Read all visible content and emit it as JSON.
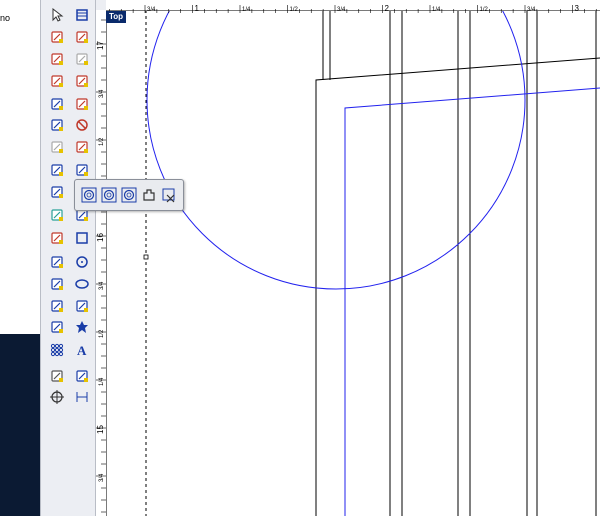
{
  "left_panel": {
    "partial_text": "no"
  },
  "view_label": "Top",
  "ruler_top": {
    "labels": [
      {
        "text": "3/4",
        "kind": "frac"
      },
      {
        "text": "1",
        "kind": "num"
      },
      {
        "text": "1/4",
        "kind": "frac"
      },
      {
        "text": "1/2",
        "kind": "frac"
      },
      {
        "text": "3/4",
        "kind": "frac"
      },
      {
        "text": "2",
        "kind": "num"
      },
      {
        "text": "1/4",
        "kind": "frac"
      },
      {
        "text": "1/2",
        "kind": "frac"
      },
      {
        "text": "3/4",
        "kind": "frac"
      },
      {
        "text": "3",
        "kind": "num"
      },
      {
        "text": "1/4",
        "kind": "frac"
      }
    ]
  },
  "ruler_left": {
    "labels": [
      {
        "text": "17",
        "kind": "num"
      },
      {
        "text": "3/4",
        "kind": "frac"
      },
      {
        "text": "1/2",
        "kind": "frac"
      },
      {
        "text": "1/4",
        "kind": "frac"
      },
      {
        "text": "16",
        "kind": "num"
      },
      {
        "text": "3/4",
        "kind": "frac"
      },
      {
        "text": "1/2",
        "kind": "frac"
      },
      {
        "text": "1/4",
        "kind": "frac"
      },
      {
        "text": "15",
        "kind": "num"
      },
      {
        "text": "3/4",
        "kind": "frac"
      }
    ]
  },
  "toolbar": {
    "tools": [
      {
        "name": "select-arrow-icon",
        "color": "#333333"
      },
      {
        "name": "layer-stack-icon",
        "color": "#1a3da8"
      },
      {
        "name": "node-edit-icon",
        "color": "#c0392b"
      },
      {
        "name": "transform-icon",
        "color": "#c0392b"
      },
      {
        "name": "resize-icon",
        "color": "#c0392b"
      },
      {
        "name": "grid-disabled-icon",
        "color": "#aaaaaa"
      },
      {
        "name": "rotate-icon",
        "color": "#c0392b"
      },
      {
        "name": "frame-icon",
        "color": "#c0392b"
      },
      {
        "name": "mirror-icon",
        "color": "#1a3da8"
      },
      {
        "name": "panel-icon",
        "color": "#c0392b"
      },
      {
        "name": "group-icon",
        "color": "#1a3da8"
      },
      {
        "name": "no-entry-icon",
        "color": "#c0392b"
      },
      {
        "name": "clone-disabled-icon",
        "color": "#aaaaaa"
      },
      {
        "name": "ruler-tool-icon",
        "color": "#c0392b"
      },
      {
        "name": "move-points-icon",
        "color": "#1a3da8"
      },
      {
        "name": "vase-icon",
        "color": "#1a3da8"
      },
      {
        "name": "boolean-icon",
        "color": "#1a3da8"
      },
      {
        "name": "hatch-icon",
        "color": "#333333"
      },
      {
        "name": "arrow-cursor-icon",
        "color": "#2aa198"
      },
      {
        "name": "curve-connect-icon",
        "color": "#1a3da8"
      },
      {
        "name": "pen-icon",
        "color": "#c0392b"
      },
      {
        "name": "rectangle-icon",
        "color": "#1a3da8"
      },
      {
        "name": "polyline-icon",
        "color": "#1a3da8"
      },
      {
        "name": "circle-icon",
        "color": "#1a3da8"
      },
      {
        "name": "bezier-icon",
        "color": "#1a3da8"
      },
      {
        "name": "ellipse-icon",
        "color": "#1a3da8"
      },
      {
        "name": "spline-icon",
        "color": "#1a3da8"
      },
      {
        "name": "polygon-icon",
        "color": "#1a3da8"
      },
      {
        "name": "fill-shape-icon",
        "color": "#1a3da8"
      },
      {
        "name": "star-icon",
        "color": "#1a3da8"
      },
      {
        "name": "array-grid-icon",
        "color": "#1a3da8"
      },
      {
        "name": "text-tool-icon",
        "color": "#1a3da8"
      },
      {
        "name": "shade-icon",
        "color": "#555555"
      },
      {
        "name": "image-icon",
        "color": "#1a3da8"
      },
      {
        "name": "target-icon",
        "color": "#333333"
      },
      {
        "name": "dimension-icon",
        "color": "#1a3da8"
      }
    ]
  },
  "flyout": {
    "tools": [
      {
        "name": "offset-inside-icon"
      },
      {
        "name": "offset-outside-icon"
      },
      {
        "name": "offset-both-icon"
      },
      {
        "name": "puzzle-offset-icon"
      },
      {
        "name": "offset-close-icon"
      }
    ]
  },
  "colors": {
    "toolbar_bg": "#eceef3",
    "geometry_blue": "#2222ee",
    "geometry_black": "#000000",
    "view_label_bg": "#0a2a6b",
    "left_dark": "#0b1a33"
  }
}
